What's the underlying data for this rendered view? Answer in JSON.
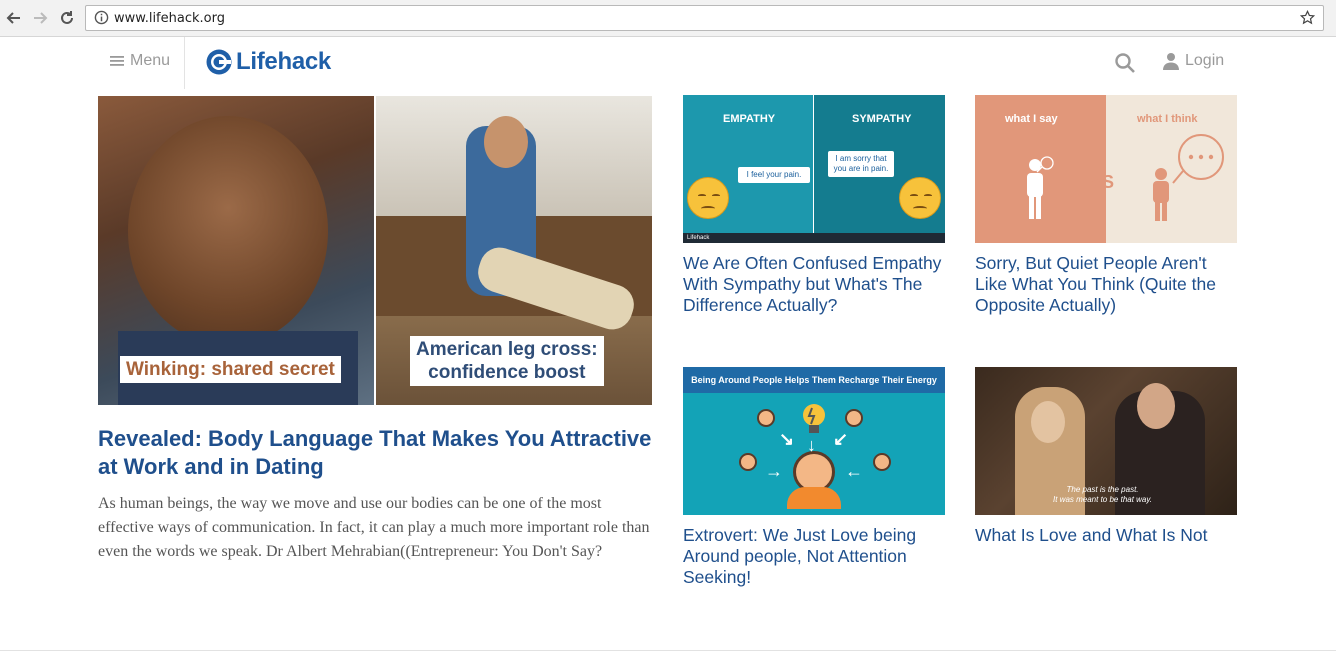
{
  "browser": {
    "url": "www.lifehack.org"
  },
  "header": {
    "menu_label": "Menu",
    "logo_text": "Lifehack",
    "login_label": "Login"
  },
  "featured": {
    "caption_left": "Winking: shared secret",
    "caption_right_line1": "American leg cross:",
    "caption_right_line2": "confidence boost",
    "title": "Revealed: Body Language That Makes You Attractive at Work and in Dating",
    "excerpt": "As human beings, the way we move and use our bodies can be one of the most effective ways of communication. In fact, it can play a much more important role than even the words we speak. Dr Albert Mehrabian((Entrepreneur: You Don't Say?"
  },
  "cards": [
    {
      "title": "We Are Often Confused Empathy With Sympathy but What's The Difference Actually?",
      "img_label_left": "EMPATHY",
      "img_label_right": "SYMPATHY",
      "bubble_left": "I feel your pain.",
      "bubble_right": "I am sorry that you are in pain.",
      "strip": "Lifehack"
    },
    {
      "title": "Sorry, But Quiet People Aren't Like What You Think (Quite the Opposite Actually)",
      "img_label_left": "what I say",
      "img_label_right": "what I think",
      "vs": "VS"
    },
    {
      "title": "Extrovert: We Just Love being Around people, Not Attention Seeking!",
      "banner": "Being Around People Helps Them Recharge Their Energy"
    },
    {
      "title": "What Is Love and What Is Not",
      "subtitle_line1": "The past is the past.",
      "subtitle_line2": "It was meant to be that way."
    }
  ],
  "colors": {
    "link": "#1f4f8c",
    "brand": "#1f5fa8",
    "teal": "#13a3b7"
  }
}
